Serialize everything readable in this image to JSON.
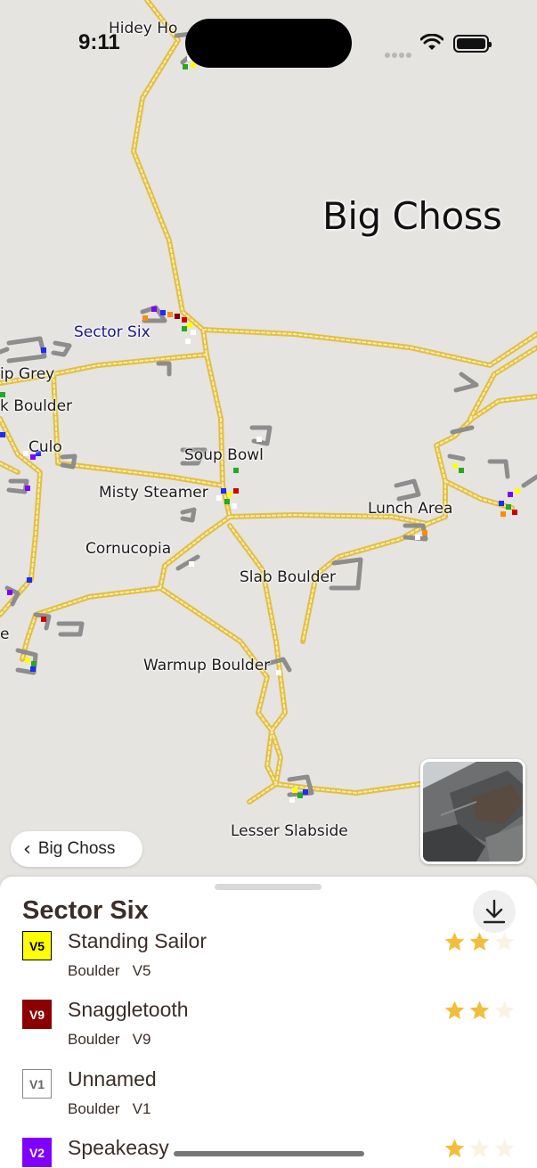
{
  "status_bar": {
    "time": "9:11"
  },
  "map": {
    "area_title": "Big Choss",
    "labels": [
      {
        "id": "hidey-ho",
        "text": "Hidey Ho"
      },
      {
        "id": "sector-six",
        "text": "Sector Six"
      },
      {
        "id": "grip-grey",
        "text": "ip Grey"
      },
      {
        "id": "k-boulder",
        "text": "k Boulder"
      },
      {
        "id": "culo",
        "text": "Culo"
      },
      {
        "id": "soup-bowl",
        "text": "Soup Bowl"
      },
      {
        "id": "misty-steamer",
        "text": "Misty Steamer"
      },
      {
        "id": "lunch-area",
        "text": "Lunch Area"
      },
      {
        "id": "cornucopia",
        "text": "Cornucopia"
      },
      {
        "id": "slab-boulder",
        "text": "Slab Boulder"
      },
      {
        "id": "e-fragment",
        "text": "e"
      },
      {
        "id": "warmup-boulder",
        "text": "Warmup Boulder"
      },
      {
        "id": "lesser-slabside",
        "text": "Lesser Slabside"
      }
    ]
  },
  "back_button": {
    "label": "Big Choss"
  },
  "sheet": {
    "title": "Sector Six",
    "routes": [
      {
        "name": "Standing Sailor",
        "type": "Boulder",
        "grade": "V5",
        "badge": "V5",
        "badge_bg": "#ffff00",
        "badge_fg": "#000000",
        "badge_border": "#000000",
        "stars": 2
      },
      {
        "name": "Snaggletooth",
        "type": "Boulder",
        "grade": "V9",
        "badge": "V9",
        "badge_bg": "#8b0000",
        "badge_fg": "#ffffff",
        "badge_border": "#8b0000",
        "stars": 2
      },
      {
        "name": "Unnamed",
        "type": "Boulder",
        "grade": "V1",
        "badge": "V1",
        "badge_bg": "#ffffff",
        "badge_fg": "#666666",
        "badge_border": "#888888",
        "stars": null
      },
      {
        "name": "Speakeasy",
        "type": "Boulder",
        "grade": "V2",
        "badge": "V2",
        "badge_bg": "#7f00ff",
        "badge_fg": "#ffffff",
        "badge_border": "#7f00ff",
        "stars": 1
      }
    ]
  },
  "colors": {
    "trail": "#e9c84a",
    "star_on": "#f2bd3b",
    "star_off": "#fbf3e2",
    "text_brown": "#3b2e28"
  }
}
